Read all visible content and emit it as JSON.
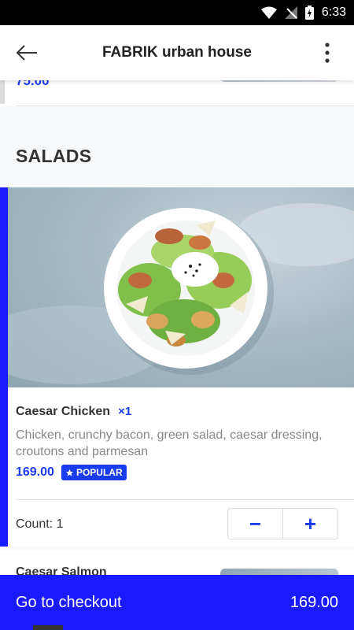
{
  "status_bar": {
    "time": "6:33"
  },
  "header": {
    "title": "FABRIK urban house"
  },
  "previous_item": {
    "price": "75.00"
  },
  "section": {
    "title": "SALADS"
  },
  "item": {
    "name": "Caesar Chicken",
    "quantity_tag": "×1",
    "description": "Chicken, crunchy bacon, green salad, caesar dressing, croutons and parmesan",
    "price": "169.00",
    "badge": "POPULAR",
    "count_label": "Count: 1",
    "decrement": "−",
    "increment": "+"
  },
  "next_item": {
    "name": "Caesar Salmon"
  },
  "checkout": {
    "label": "Go to checkout",
    "total": "169.00"
  },
  "colors": {
    "accent": "#1a3cf0",
    "checkout_bg": "#1a1aff"
  }
}
